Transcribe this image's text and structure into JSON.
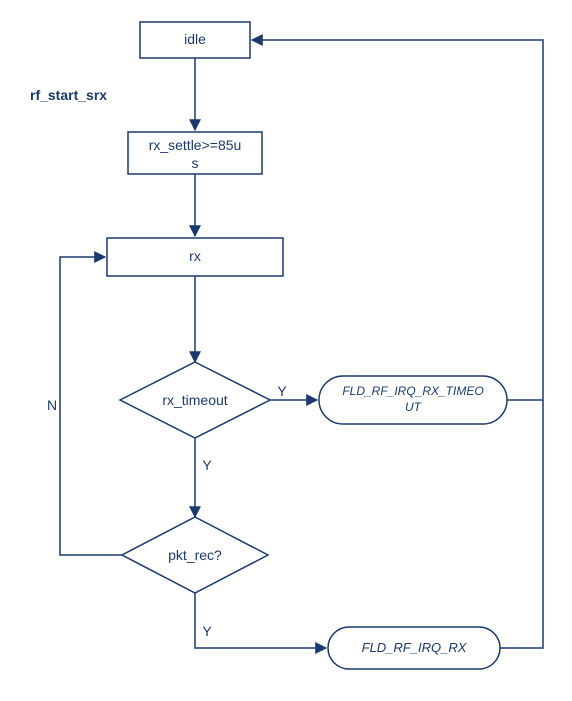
{
  "diagram": {
    "annotation": "rf_start_srx",
    "nodes": {
      "idle": "idle",
      "rx_settle": "rx_settle>=85us",
      "rx": "rx",
      "rx_timeout": "rx_timeout",
      "irq_timeout": "FLD_RF_IRQ_RX_TIMEOUT",
      "pkt_rec": "pkt_rec?",
      "irq_rx": "FLD_RF_IRQ_RX"
    },
    "edges": {
      "Y": "Y",
      "N": "N"
    }
  },
  "chart_data": {
    "type": "flowchart",
    "title": "",
    "nodes": [
      {
        "id": "idle",
        "kind": "process",
        "label": "idle"
      },
      {
        "id": "rx_settle",
        "kind": "process",
        "label": "rx_settle>=85us"
      },
      {
        "id": "rx",
        "kind": "process",
        "label": "rx"
      },
      {
        "id": "rx_timeout",
        "kind": "decision",
        "label": "rx_timeout"
      },
      {
        "id": "irq_timeout",
        "kind": "terminator",
        "label": "FLD_RF_IRQ_RX_TIMEOUT"
      },
      {
        "id": "pkt_rec",
        "kind": "decision",
        "label": "pkt_rec?"
      },
      {
        "id": "irq_rx",
        "kind": "terminator",
        "label": "FLD_RF_IRQ_RX"
      }
    ],
    "edges": [
      {
        "from": "idle",
        "to": "rx_settle",
        "label": "rf_start_srx"
      },
      {
        "from": "rx_settle",
        "to": "rx",
        "label": ""
      },
      {
        "from": "rx",
        "to": "rx_timeout",
        "label": ""
      },
      {
        "from": "rx_timeout",
        "to": "irq_timeout",
        "label": "Y"
      },
      {
        "from": "rx_timeout",
        "to": "pkt_rec",
        "label": "Y"
      },
      {
        "from": "pkt_rec",
        "to": "rx",
        "label": "N"
      },
      {
        "from": "pkt_rec",
        "to": "irq_rx",
        "label": "Y"
      },
      {
        "from": "irq_timeout",
        "to": "idle",
        "label": ""
      },
      {
        "from": "irq_rx",
        "to": "idle",
        "label": ""
      }
    ]
  }
}
